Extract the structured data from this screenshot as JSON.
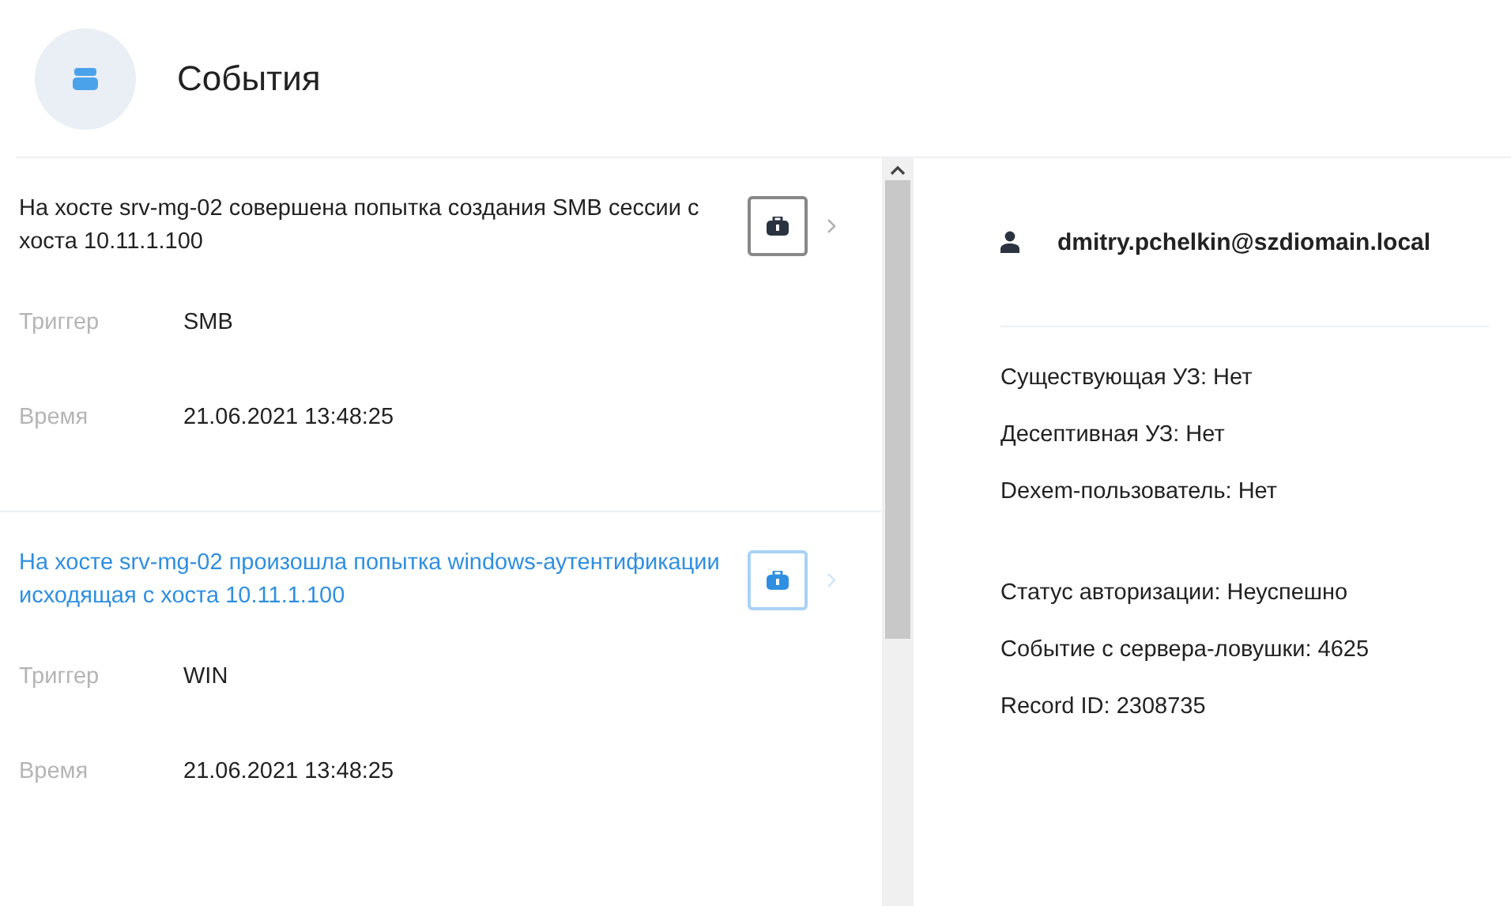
{
  "header": {
    "title": "События"
  },
  "events": [
    {
      "title": "На хосте srv-mg-02 совершена попытка создания SMB сессии с хоста 10.11.1.100",
      "selected": false,
      "fields": [
        {
          "label": "Триггер",
          "value": "SMB"
        },
        {
          "label": "Время",
          "value": "21.06.2021 13:48:25"
        }
      ]
    },
    {
      "title": "На хосте srv-mg-02 произошла попытка windows-аутентификации исходящая с хоста 10.11.1.100",
      "selected": true,
      "fields": [
        {
          "label": "Триггер",
          "value": "WIN"
        },
        {
          "label": "Время",
          "value": "21.06.2021 13:48:25"
        }
      ]
    }
  ],
  "details": {
    "user": "dmitry.pchelkin@szdiomain.local",
    "groups": [
      [
        "Существующая УЗ: Нет",
        "Десептивная УЗ: Нет",
        "Dexem-пользователь: Нет"
      ],
      [
        "Статус авторизации: Неуспешно",
        "Событие с сервера-ловушки: 4625",
        "Record ID: 2308735"
      ]
    ]
  }
}
